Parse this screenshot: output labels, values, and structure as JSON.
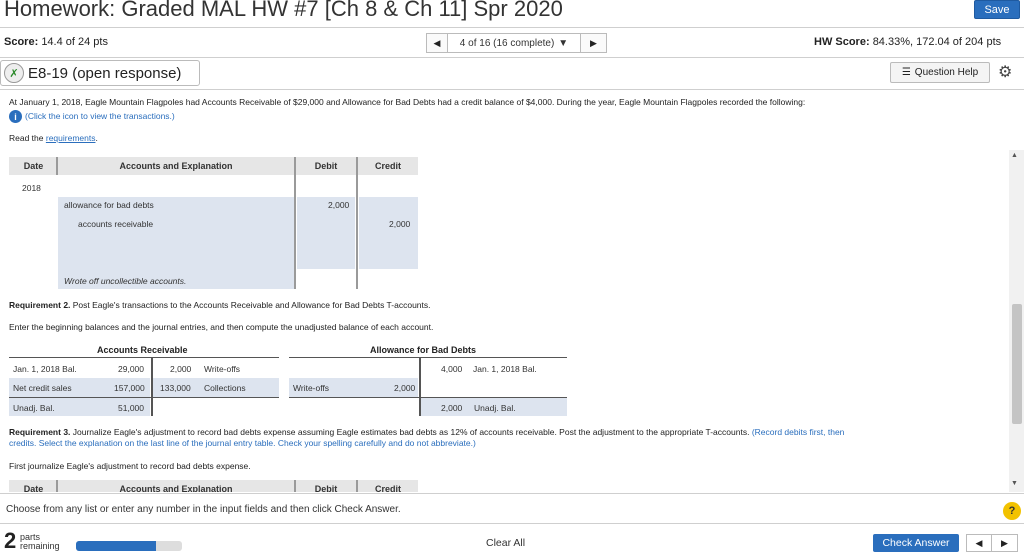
{
  "header": {
    "title": "Homework: Graded MAL HW #7 [Ch 8 & Ch 11] Spr 2020",
    "save_label": "Save",
    "score_label": "Score:",
    "score_value": "14.4 of 24 pts",
    "nav_position": "4 of 16 (16 complete)",
    "hw_score_label": "HW Score:",
    "hw_score_value": "84.33%, 172.04 of 204 pts"
  },
  "question": {
    "id_label": "E8-19 (open response)",
    "help_label": "Question Help"
  },
  "intro": {
    "text": "At January 1, 2018, Eagle Mountain Flagpoles had Accounts Receivable of $29,000 and Allowance for Bad Debts had a credit balance of $4,000. During the year, Eagle Mountain Flagpoles recorded the following:",
    "click_icon_text": "(Click the icon to view the transactions.)",
    "read_prefix": "Read the ",
    "requirements_link": "requirements",
    "read_suffix": "."
  },
  "journal1": {
    "headers": {
      "date": "Date",
      "accounts": "Accounts and Explanation",
      "debit": "Debit",
      "credit": "Credit"
    },
    "year": "2018",
    "row1": {
      "account": "allowance for bad debts",
      "debit": "2,000"
    },
    "row2": {
      "account": "accounts receivable",
      "credit": "2,000"
    },
    "explanation": "Wrote off uncollectible accounts."
  },
  "req2": {
    "bold": "Requirement 2.",
    "text": " Post Eagle's transactions to the Accounts Receivable and Allowance for Bad Debts T-accounts.",
    "instruction": "Enter the beginning balances and the journal entries, and then compute the unadjusted balance of each account."
  },
  "t_ar": {
    "title": "Accounts Receivable",
    "rows": [
      {
        "left_label": "Jan. 1, 2018 Bal.",
        "left_value": "29,000",
        "right_value": "2,000",
        "right_label": "Write-offs"
      },
      {
        "left_label": "Net credit sales",
        "left_value": "157,000",
        "right_value": "133,000",
        "right_label": "Collections"
      }
    ],
    "total_label": "Unadj. Bal.",
    "total_value": "51,000"
  },
  "t_allow": {
    "title": "Allowance for Bad Debts",
    "row1": {
      "right_value": "4,000",
      "right_label": "Jan. 1, 2018 Bal."
    },
    "row2": {
      "left_label": "Write-offs",
      "left_value": "2,000"
    },
    "total_value": "2,000",
    "total_label": "Unadj. Bal."
  },
  "req3": {
    "bold": "Requirement 3.",
    "text": " Journalize Eagle's adjustment to record bad debts expense assuming Eagle estimates bad debts as 12% of accounts receivable. Post the adjustment to the appropriate T-accounts.",
    "blue_text_1": " (Record debits first, then",
    "blue_text_2": "credits. Select the explanation on the last line of the journal entry table. Check your spelling carefully and do not abbreviate.)",
    "instruction": "First journalize Eagle's adjustment to record bad debts expense."
  },
  "journal2": {
    "headers": {
      "date": "Date",
      "accounts": "Accounts and Explanation",
      "debit": "Debit",
      "credit": "Credit"
    }
  },
  "footer": {
    "instruction": "Choose from any list or enter any number in the input fields and then click Check Answer.",
    "help_symbol": "?",
    "parts_count": "2",
    "parts_label_1": "parts",
    "parts_label_2": "remaining",
    "progress_fraction": 0.75,
    "clear_label": "Clear All",
    "check_label": "Check Answer"
  },
  "icons": [
    "question-status-icon",
    "list-icon",
    "gear-icon",
    "info-icon",
    "help-icon",
    "arrow-left-icon",
    "arrow-right-icon",
    "dropdown-arrow-icon"
  ],
  "colors": {
    "accent": "#2a6ebd",
    "input_bg": "#dde4ef",
    "help_yellow": "#f2c200"
  }
}
